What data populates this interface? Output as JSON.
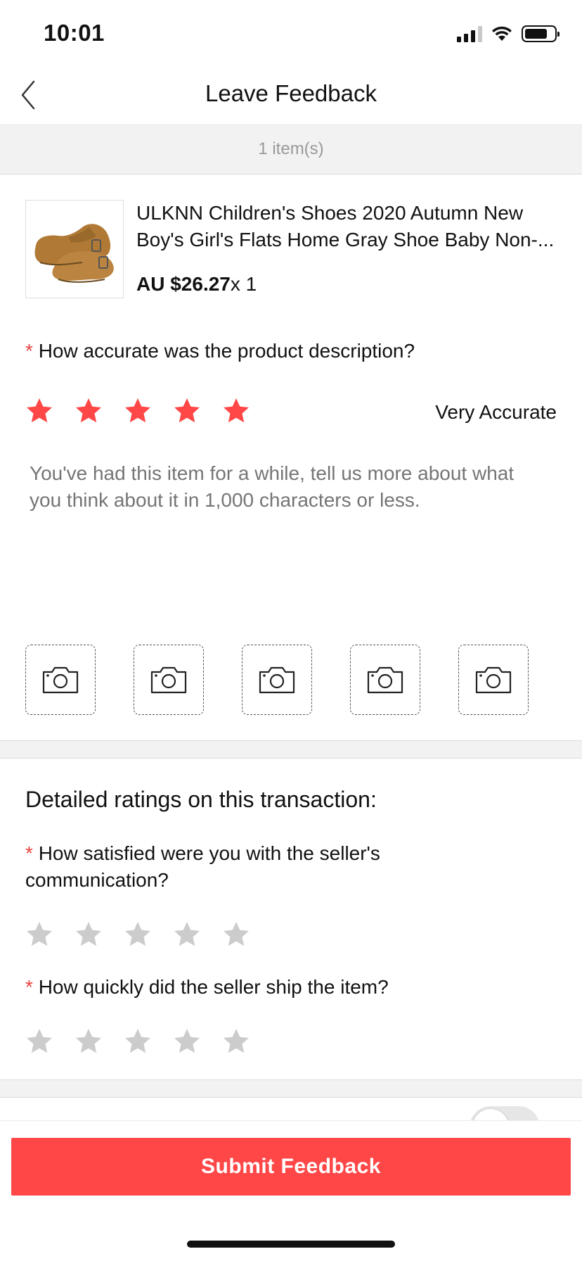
{
  "status_bar": {
    "time": "10:01"
  },
  "nav": {
    "title": "Leave Feedback"
  },
  "items_count": "1 item(s)",
  "product": {
    "title_line1": "ULKNN Children's Shoes 2020 Autumn New",
    "title_line2": "Boy's Girl's Flats Home Gray Shoe Baby Non-...",
    "price": "AU $26.27",
    "quantity": "x 1"
  },
  "required_marker": "*",
  "q_description": {
    "label": "How accurate was the product description?",
    "rating": 5,
    "max": 5,
    "rating_label": "Very Accurate"
  },
  "feedback": {
    "placeholder": "You've had this item for a while, tell us more about what you think about it in 1,000 characters or less."
  },
  "photo_slots": 5,
  "detailed": {
    "title": "Detailed ratings on this transaction:",
    "communication": {
      "label_line1": "How satisfied were you with the seller's",
      "label_line2": "communication?",
      "rating": 0,
      "max": 5
    },
    "shipping": {
      "label": "How quickly did the seller ship the item?",
      "rating": 0,
      "max": 5
    }
  },
  "submit_label": "Submit Feedback",
  "colors": {
    "accent": "#ff4747",
    "star_active": "#ff4747",
    "star_inactive": "#cccccc",
    "required": "#e64340"
  },
  "icons": {
    "back": "chevron-left-icon",
    "star": "star-icon",
    "camera": "camera-icon"
  }
}
